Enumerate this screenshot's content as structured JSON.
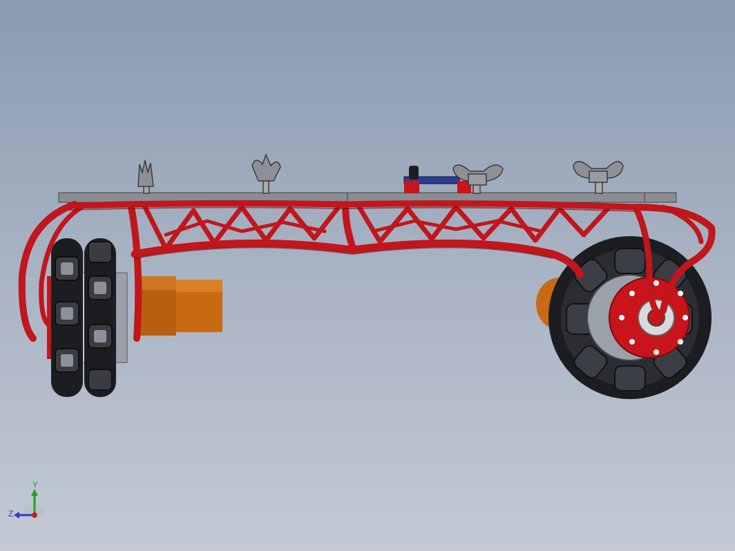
{
  "viewport": {
    "background_top": "#8b9bb0",
    "background_bottom": "#c4c9d4"
  },
  "colors": {
    "frame_red": "#c0161c",
    "frame_dark": "#7a0d10",
    "plate_gray": "#8a8d92",
    "wheel_black": "#1c1d20",
    "hub_red": "#c8141a",
    "motor_orange": "#c86a14",
    "axis_y": "#1aa31a",
    "axis_z": "#2a3cc8",
    "axis_x": "#d01818"
  },
  "triad": {
    "y_label": "Y",
    "z_label": "Z"
  }
}
